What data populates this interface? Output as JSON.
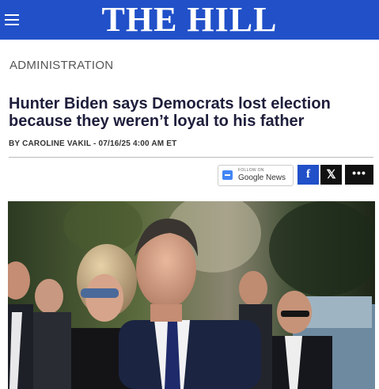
{
  "header": {
    "logo_text": "THE HILL",
    "menu_icon": "hamburger-menu-icon",
    "background_color": "#2150c8"
  },
  "article": {
    "section": "ADMINISTRATION",
    "title": "Hunter Biden says Democrats lost election because they weren’t loyal to his father",
    "byline": "BY CAROLINE VAKIL - 07/16/25 4:00 AM ET"
  },
  "share": {
    "google_news": {
      "follow_on": "FOLLOW ON",
      "name": "Google News",
      "icon": "google-news-icon"
    },
    "facebook": {
      "glyph": "f",
      "icon": "facebook-icon",
      "color": "#2150c8"
    },
    "x": {
      "glyph": "𝕏",
      "icon": "x-logo-icon"
    },
    "more": {
      "glyph": "•••",
      "icon": "more-icon"
    }
  }
}
